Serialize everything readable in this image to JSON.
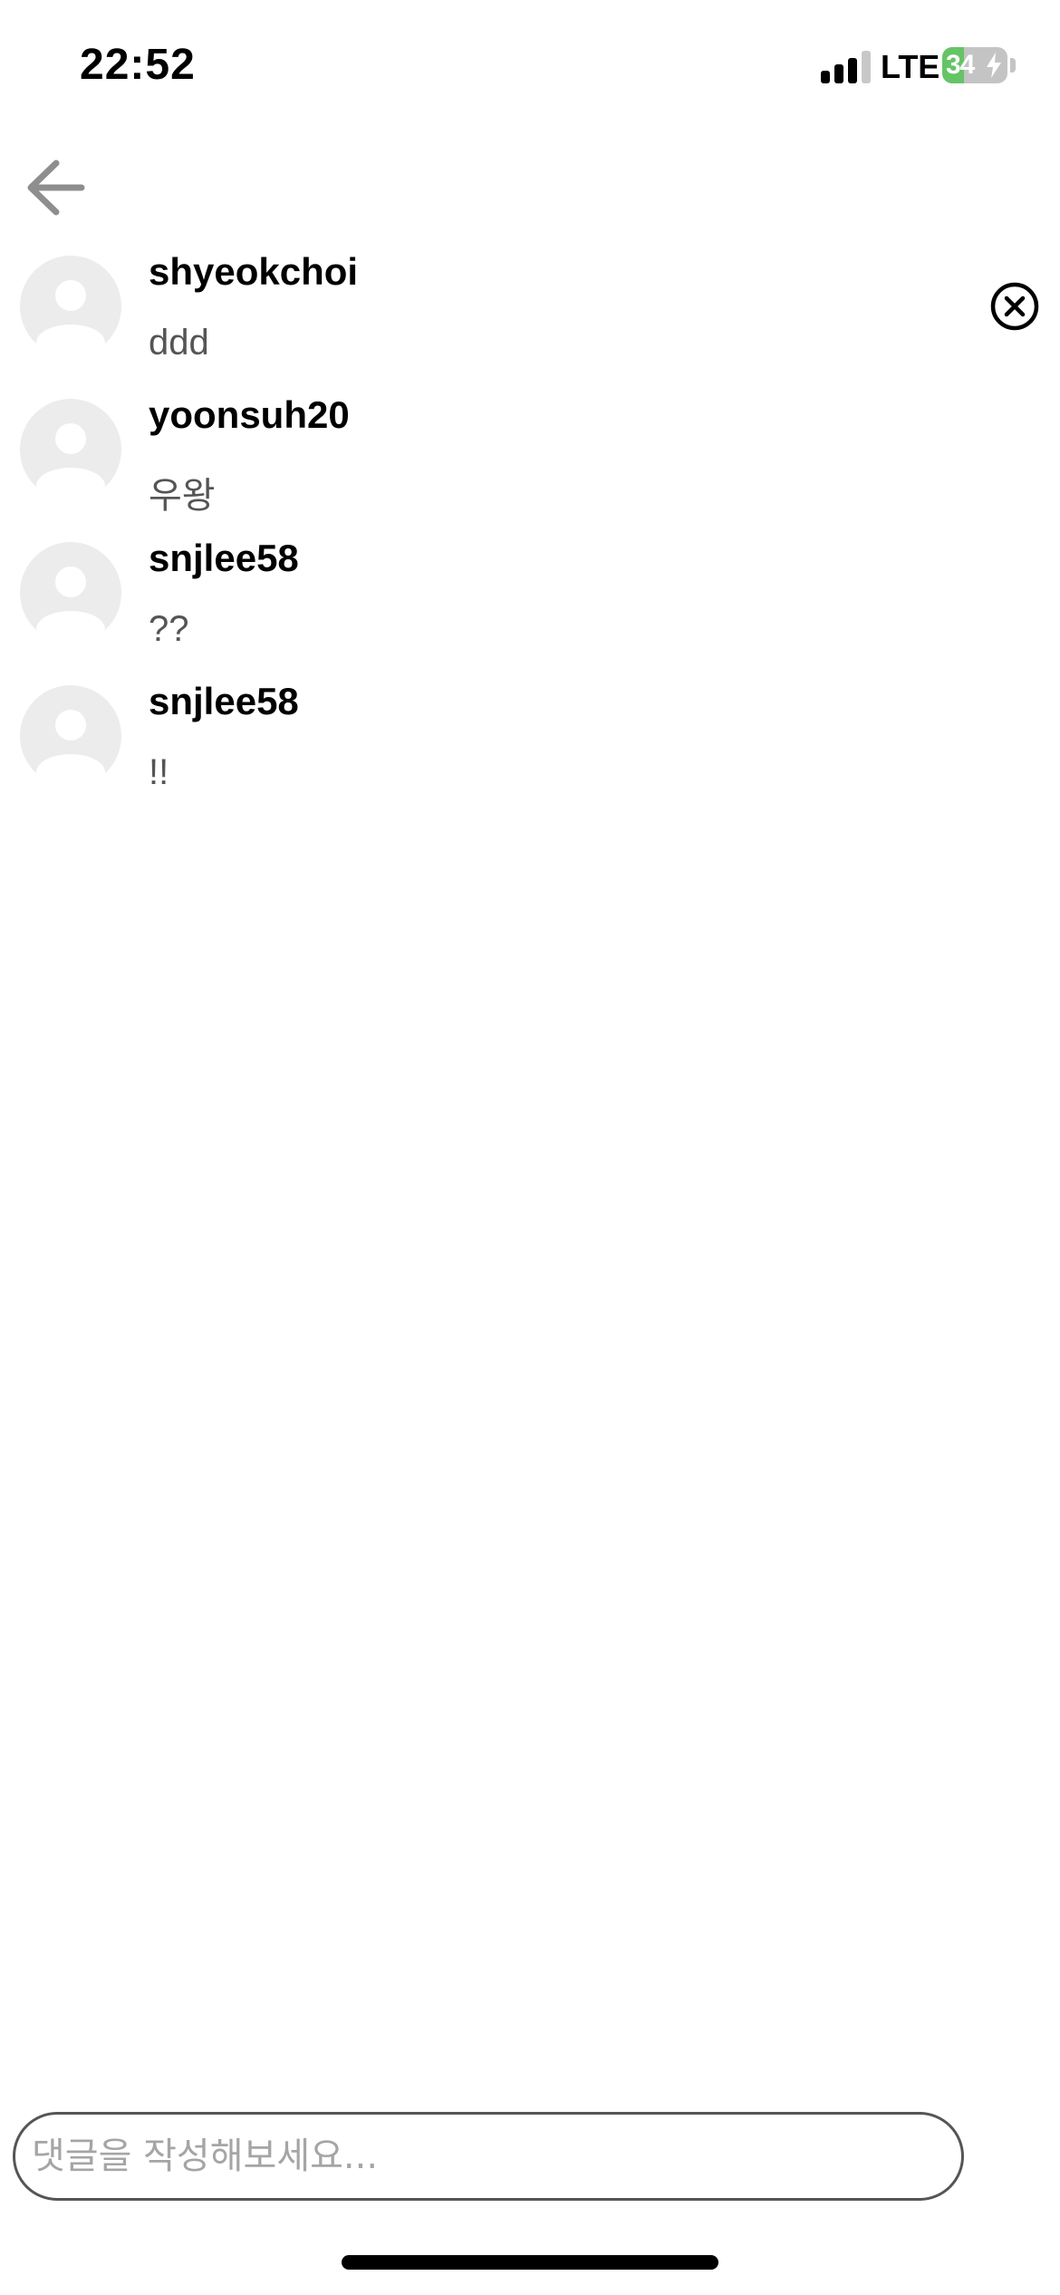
{
  "status_bar": {
    "time": "22:52",
    "network": "LTE",
    "battery_level": "34",
    "battery_fraction": 0.34,
    "battery_color": "#65c466",
    "icons": [
      "signal-icon",
      "battery-icon",
      "charging-bolt-icon"
    ]
  },
  "navigation": {
    "back_icon": "arrow-left-icon"
  },
  "comments": [
    {
      "username": "shyeokchoi",
      "text": "ddd",
      "deletable": true,
      "delete_icon": "close-circle-icon"
    },
    {
      "username": "yoonsuh20",
      "text": "우왕",
      "deletable": false
    },
    {
      "username": "snjlee58",
      "text": "??",
      "deletable": false
    },
    {
      "username": "snjlee58",
      "text": "!!",
      "deletable": false
    }
  ],
  "input": {
    "placeholder": "댓글을 작성해보세요...",
    "value": ""
  }
}
